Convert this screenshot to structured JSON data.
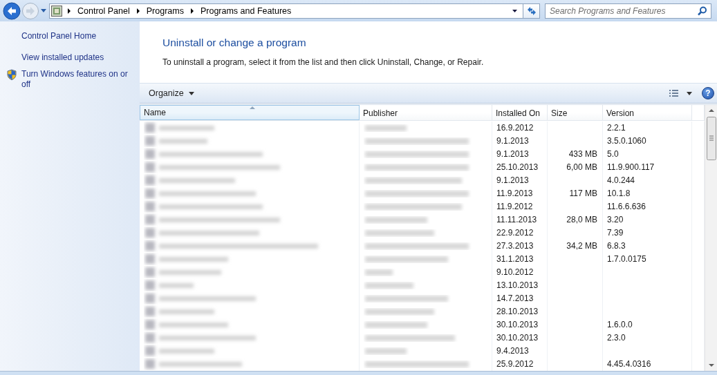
{
  "address_bar": {
    "breadcrumbs": [
      "Control Panel",
      "Programs",
      "Programs and Features"
    ],
    "search": {
      "placeholder": "Search Programs and Features"
    }
  },
  "sidebar": {
    "links": [
      {
        "label": "Control Panel Home",
        "kind": "plain"
      },
      {
        "label": "View installed updates",
        "kind": "plain"
      },
      {
        "label": "Turn Windows features on or off",
        "kind": "shield"
      }
    ]
  },
  "content": {
    "title": "Uninstall or change a program",
    "description": "To uninstall a program, select it from the list and then click Uninstall, Change, or Repair."
  },
  "toolbar": {
    "organize": "Organize",
    "help_glyph": "?"
  },
  "table": {
    "columns": [
      {
        "label": "Name",
        "sorted": true
      },
      {
        "label": "Publisher",
        "sorted": false
      },
      {
        "label": "Installed On",
        "sorted": false
      },
      {
        "label": "Size",
        "sorted": false
      },
      {
        "label": "Version",
        "sorted": false
      }
    ],
    "rows": [
      {
        "installed_on": "16.9.2012",
        "version": "2.2.1"
      },
      {
        "installed_on": "9.1.2013",
        "version": "3.5.0.1060"
      },
      {
        "installed_on": "9.1.2013",
        "size": "433 MB",
        "version": "5.0"
      },
      {
        "installed_on": "25.10.2013",
        "size": "6,00 MB",
        "version": "11.9.900.117"
      },
      {
        "installed_on": "9.1.2013",
        "version": "4.0.244"
      },
      {
        "installed_on": "11.9.2013",
        "size": "117 MB",
        "version": "10.1.8"
      },
      {
        "installed_on": "11.9.2012",
        "version": "11.6.6.636"
      },
      {
        "installed_on": "11.11.2013",
        "size": "28,0 MB",
        "version": "3.20"
      },
      {
        "installed_on": "22.9.2012",
        "version": "7.39"
      },
      {
        "installed_on": "27.3.2013",
        "size": "34,2 MB",
        "version": "6.8.3"
      },
      {
        "installed_on": "31.1.2013",
        "version": "1.7.0.0175"
      },
      {
        "installed_on": "9.10.2012"
      },
      {
        "installed_on": "13.10.2013"
      },
      {
        "installed_on": "14.7.2013"
      },
      {
        "installed_on": "28.10.2013"
      },
      {
        "installed_on": "30.10.2013",
        "version": "1.6.0.0"
      },
      {
        "installed_on": "30.10.2013",
        "version": "2.3.0"
      },
      {
        "installed_on": "9.4.2013"
      },
      {
        "installed_on": "25.9.2012",
        "version": "4.45.4.0316"
      }
    ]
  }
}
